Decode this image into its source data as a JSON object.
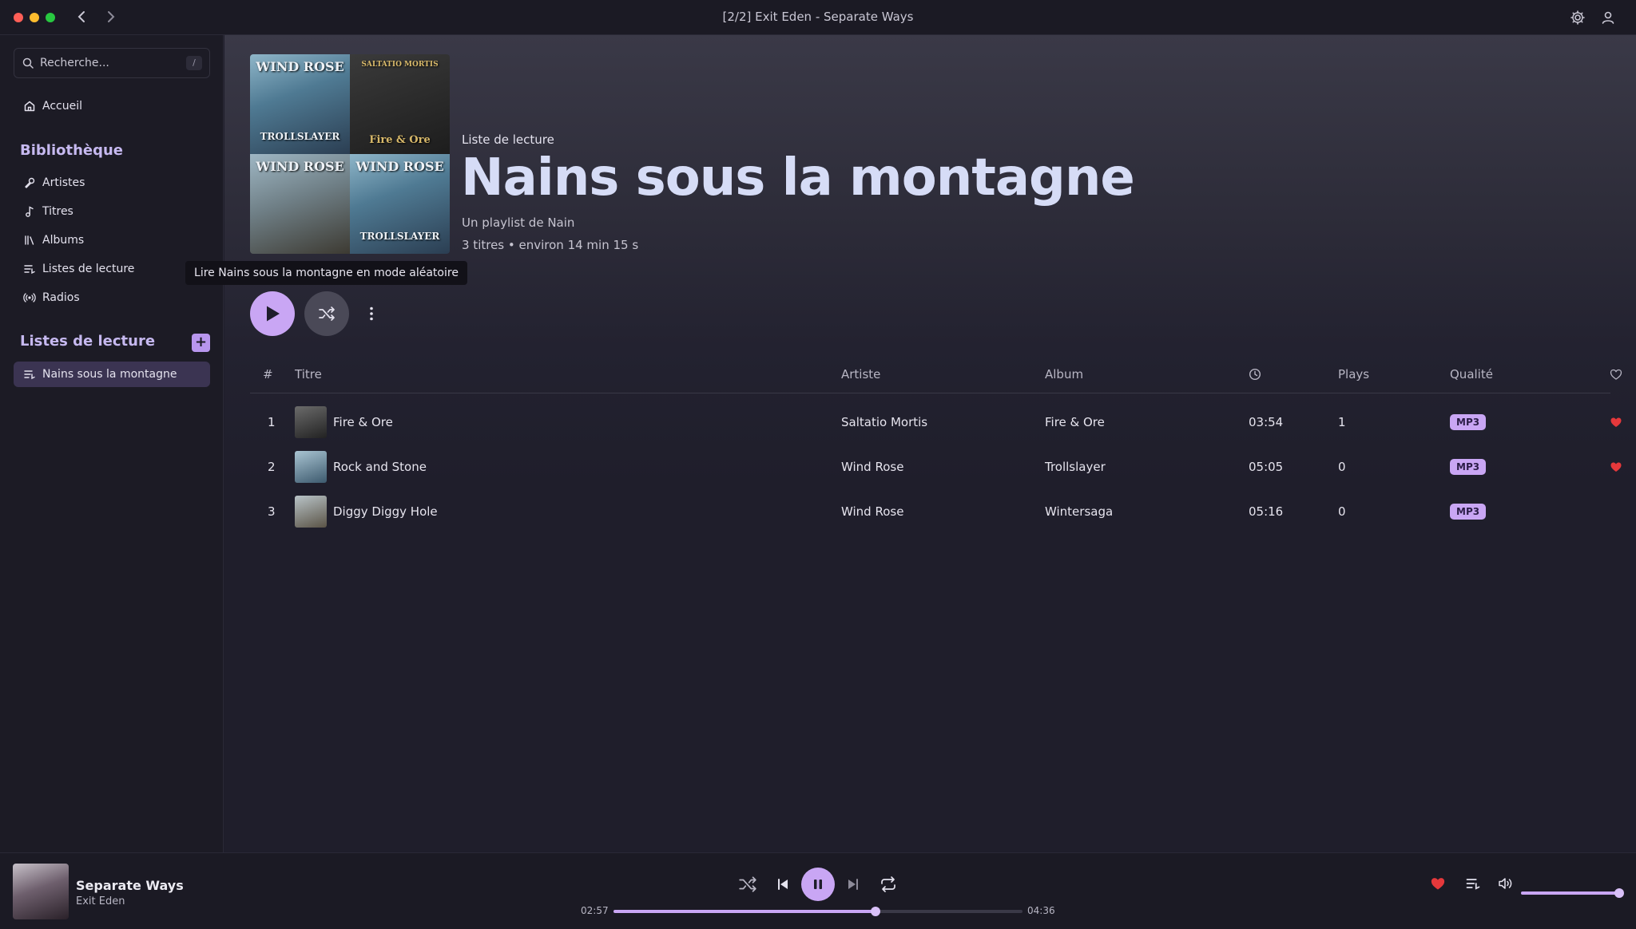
{
  "window": {
    "title": "[2/2] Exit Eden - Separate Ways"
  },
  "sidebar": {
    "search_placeholder": "Recherche...",
    "search_shortcut": "/",
    "home_label": "Accueil",
    "library_title": "Bibliothèque",
    "library_items": [
      {
        "label": "Artistes",
        "icon": "microphone-icon"
      },
      {
        "label": "Titres",
        "icon": "music-note-icon"
      },
      {
        "label": "Albums",
        "icon": "library-icon"
      },
      {
        "label": "Listes de lecture",
        "icon": "playlist-icon"
      },
      {
        "label": "Radios",
        "icon": "radio-icon"
      }
    ],
    "playlists_title": "Listes de lecture",
    "add_label": "+",
    "playlists": [
      {
        "label": "Nains sous la montagne",
        "active": true
      }
    ]
  },
  "header": {
    "type_label": "Liste de lecture",
    "title": "Nains sous la montagne",
    "owner": "Un playlist de Nain",
    "meta": "3 titres • environ 14 min 15 s",
    "cover_texts": [
      "WIND ROSE",
      "TROLLSLAYER",
      "SALTATIO MORTIS",
      "Fire & Ore",
      "WIND ROSE",
      "WIND ROSE",
      "TROLLSLAYER"
    ]
  },
  "tooltip": "Lire Nains sous la montagne en mode aléatoire",
  "table": {
    "columns": {
      "index": "#",
      "title": "Titre",
      "artist": "Artiste",
      "album": "Album",
      "plays": "Plays",
      "quality": "Qualité"
    },
    "rows": [
      {
        "index": "1",
        "title": "Fire & Ore",
        "artist": "Saltatio Mortis",
        "album": "Fire & Ore",
        "duration": "03:54",
        "plays": "1",
        "quality": "MP3",
        "liked": true
      },
      {
        "index": "2",
        "title": "Rock and Stone",
        "artist": "Wind Rose",
        "album": "Trollslayer",
        "duration": "05:05",
        "plays": "0",
        "quality": "MP3",
        "liked": true
      },
      {
        "index": "3",
        "title": "Diggy Diggy Hole",
        "artist": "Wind Rose",
        "album": "Wintersaga",
        "duration": "05:16",
        "plays": "0",
        "quality": "MP3",
        "liked": false
      }
    ]
  },
  "player": {
    "title": "Separate Ways",
    "artist": "Exit Eden",
    "elapsed": "02:57",
    "total": "04:36",
    "progress_percent": 64,
    "volume_percent": 100,
    "liked": true
  },
  "colors": {
    "accent": "#c9a6f4",
    "heart": "#e5383b",
    "background": "#1f1e2b"
  }
}
